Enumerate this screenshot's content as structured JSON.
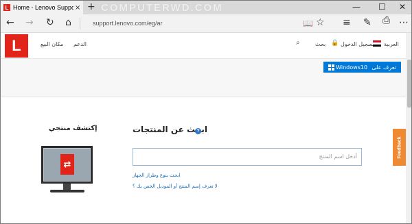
{
  "browser": {
    "tab_title": "Home - Lenovo Suppor",
    "tab_favicon": "L",
    "tab_close": "×",
    "new_tab": "+",
    "watermark": "COMPUTERWD.COM",
    "url": "support.lenovo.com/eg/ar",
    "icons": [
      "back-icon",
      "forward-icon",
      "refresh-icon",
      "home-icon",
      "reading-view-icon",
      "favorite-star-icon",
      "hub-icon",
      "pen-icon",
      "more-icon"
    ]
  },
  "site": {
    "logo": "L",
    "nav_left": [
      "مكان البيع",
      "الدعم"
    ],
    "nav_right": {
      "search": "بحث",
      "login": "تسجيل الدخول",
      "language": "العربية"
    },
    "windows_banner": {
      "label": "تعرف على",
      "product": "Windows10"
    },
    "search_section": {
      "heading": "ابحث عن المنتجات",
      "placeholder": "أدخل اسم المنتج",
      "link_browse": "ابحث بنوع وطراز الجهاز",
      "link_unknown": "لا تعرف إسم المنتج أو الموديل الخص بك ؟"
    },
    "detect_section": {
      "heading": "إكتشف منتجي",
      "monitor_symbol": "⇄"
    },
    "feedback": "Feedback"
  },
  "colors": {
    "lenovo_red": "#e2231a",
    "windows_blue": "#0078d7",
    "feedback_orange": "#f08a32",
    "link_blue": "#1f6fb5"
  }
}
